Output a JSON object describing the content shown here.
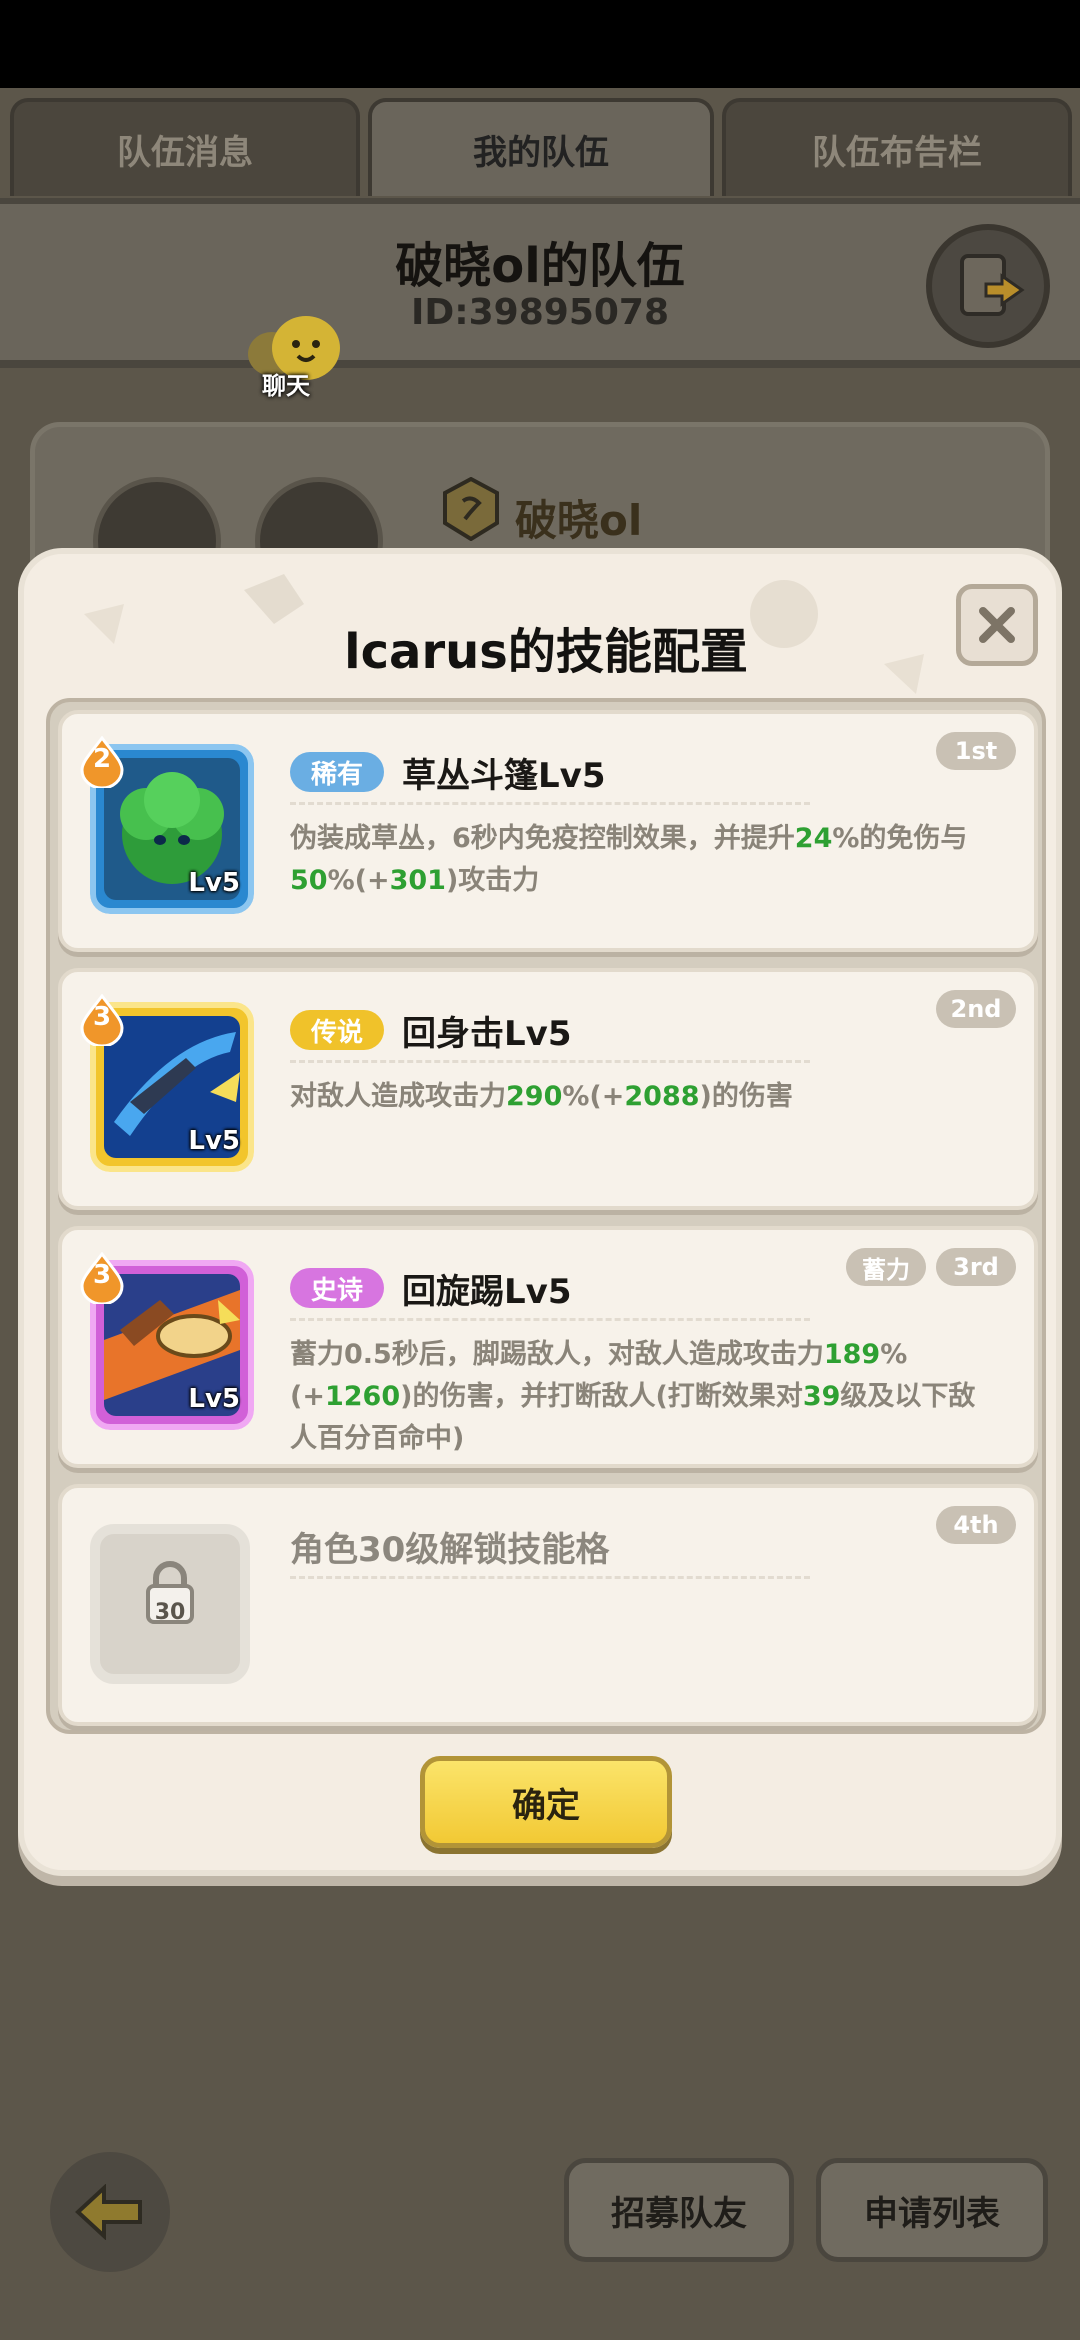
{
  "tabs": [
    {
      "label": "队伍消息",
      "active": false
    },
    {
      "label": "我的队伍",
      "active": true
    },
    {
      "label": "队伍布告栏",
      "active": false
    }
  ],
  "team": {
    "name": "破晓ol的队伍",
    "id_text": "ID:39895078",
    "chat_label": "聊天",
    "member_name": "破晓ol"
  },
  "modal": {
    "title": "lcarus的技能配置",
    "confirm_label": "确定",
    "skills": [
      {
        "order": "1st",
        "stars": "2",
        "rarity": "稀有",
        "rarity_color": "#6aaee3",
        "name": "草丛斗篷Lv5",
        "level": "Lv5",
        "desc_parts": [
          "伪装成草丛，6秒内免疫控制效果，并提升",
          "24",
          "%的免伤与",
          "50",
          "%(+",
          "301",
          ")攻击力"
        ]
      },
      {
        "order": "2nd",
        "stars": "3",
        "rarity": "传说",
        "rarity_color": "#f0c22a",
        "name": "回身击Lv5",
        "level": "Lv5",
        "desc_parts": [
          "对敌人造成攻击力",
          "290",
          "%(+",
          "2088",
          ")的伤害"
        ]
      },
      {
        "order": "3rd",
        "charge": "蓄力",
        "stars": "3",
        "rarity": "史诗",
        "rarity_color": "#d775e0",
        "name": "回旋踢Lv5",
        "level": "Lv5",
        "desc_parts": [
          "蓄力0.5秒后，脚踢敌人，对敌人造成攻击力",
          "189",
          "%(+",
          "1260",
          ")的伤害，并打断敌人(打断效果对",
          "39",
          "级及以下敌人百分百命中)"
        ]
      },
      {
        "order": "4th",
        "locked_text": "角色30级解锁技能格",
        "lock_level": "30"
      }
    ]
  },
  "bottom": {
    "recruit_label": "招募队友",
    "apply_list_label": "申请列表"
  },
  "colors": {
    "green_value": "#2ea032",
    "confirm_yellow": "#f5d13f"
  }
}
